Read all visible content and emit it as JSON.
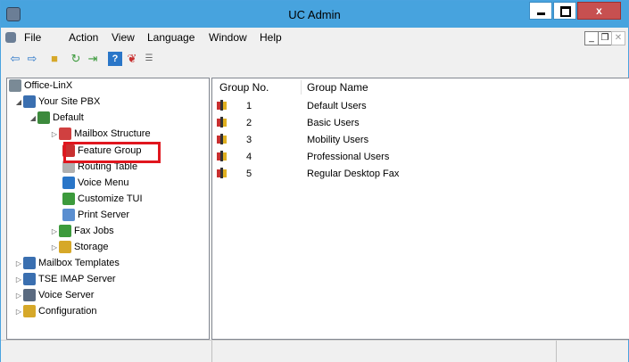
{
  "window": {
    "title": "UC Admin"
  },
  "menubar": {
    "items": [
      "File",
      "Action",
      "View",
      "Language",
      "Window",
      "Help"
    ]
  },
  "toolbar": {
    "icons": [
      "back-arrow-icon",
      "forward-arrow-icon",
      "up-folder-icon",
      "refresh-icon",
      "export-icon",
      "help-icon",
      "feature-icon",
      "properties-icon"
    ]
  },
  "tree": {
    "items": [
      {
        "label": "Office-LinX",
        "icon": "network-icon",
        "color": "#7a8a96"
      },
      {
        "label": "Your Site PBX",
        "icon": "pbx-icon",
        "color": "#3a6fb0"
      },
      {
        "label": "Default",
        "icon": "default-icon",
        "color": "#3c8a3c"
      },
      {
        "label": "Mailbox Structure",
        "icon": "mailbox-structure-icon",
        "color": "#d04040"
      },
      {
        "label": "Feature Group",
        "icon": "feature-group-icon",
        "color": "#c83030"
      },
      {
        "label": "Routing Table",
        "icon": "routing-table-icon",
        "color": "#b0b0b0"
      },
      {
        "label": "Voice Menu",
        "icon": "voice-menu-icon",
        "color": "#2a76c8"
      },
      {
        "label": "Customize TUI",
        "icon": "customize-tui-icon",
        "color": "#3c9a3c"
      },
      {
        "label": "Print Server",
        "icon": "print-server-icon",
        "color": "#5a8ed0"
      },
      {
        "label": "Fax Jobs",
        "icon": "fax-jobs-icon",
        "color": "#3c9a3c"
      },
      {
        "label": "Storage",
        "icon": "storage-icon",
        "color": "#d6a829"
      },
      {
        "label": "Mailbox Templates",
        "icon": "mailbox-templates-icon",
        "color": "#3a6fb0"
      },
      {
        "label": "TSE IMAP Server",
        "icon": "imap-server-icon",
        "color": "#3a6fb0"
      },
      {
        "label": "Voice Server",
        "icon": "voice-server-icon",
        "color": "#5a6a80"
      },
      {
        "label": "Configuration",
        "icon": "configuration-icon",
        "color": "#d6a829"
      }
    ]
  },
  "list": {
    "columns": [
      "Group No.",
      "Group Name"
    ],
    "rows": [
      {
        "no": "1",
        "name": "Default Users"
      },
      {
        "no": "2",
        "name": "Basic Users"
      },
      {
        "no": "3",
        "name": "Mobility Users"
      },
      {
        "no": "4",
        "name": "Professional Users"
      },
      {
        "no": "5",
        "name": "Regular Desktop Fax"
      }
    ]
  },
  "colors": {
    "titlebar": "#47a3de",
    "highlight": "#e0161e",
    "close": "#c75050"
  }
}
